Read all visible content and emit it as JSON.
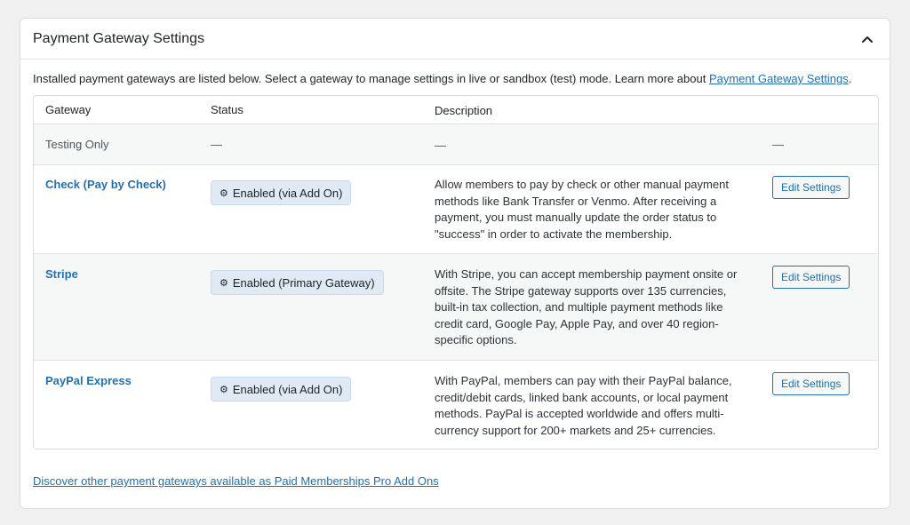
{
  "panel": {
    "title": "Payment Gateway Settings",
    "intro_text": "Installed payment gateways are listed below. Select a gateway to manage settings in live or sandbox (test) mode. Learn more about ",
    "intro_link": "Payment Gateway Settings",
    "intro_end": ".",
    "footer_link": "Discover other payment gateways available as Paid Memberships Pro Add Ons"
  },
  "table": {
    "headers": {
      "gateway": "Gateway",
      "status": "Status",
      "description": "Description"
    },
    "rows": [
      {
        "gateway": "Testing Only",
        "status": "—",
        "description": "—",
        "action": "—"
      },
      {
        "gateway": "Check (Pay by Check)",
        "status": "Enabled (via Add On)",
        "description": "Allow members to pay by check or other manual payment methods like Bank Transfer or Venmo. After receiving a payment, you must manually update the order status to \"success\" in order to activate the membership.",
        "action": "Edit Settings"
      },
      {
        "gateway": "Stripe",
        "status": "Enabled (Primary Gateway)",
        "description": "With Stripe, you can accept membership payment onsite or offsite. The Stripe gateway supports over 135 currencies, built-in tax collection, and multiple payment methods like credit card, Google Pay, Apple Pay, and over 40 region-specific options.",
        "action": "Edit Settings"
      },
      {
        "gateway": "PayPal Express",
        "status": "Enabled (via Add On)",
        "description": "With PayPal, members can pay with their PayPal balance, credit/debit cards, linked bank accounts, or local payment methods. PayPal is accepted worldwide and offers multi-currency support for 200+ markets and 25+ currencies.",
        "action": "Edit Settings"
      }
    ]
  },
  "icons": {
    "collapse": "chevron-up-icon",
    "status": "gear-icon"
  },
  "colors": {
    "link": "#2271b1",
    "badge_bg": "#dfeaf5",
    "row_alt": "#f6f7f7"
  }
}
